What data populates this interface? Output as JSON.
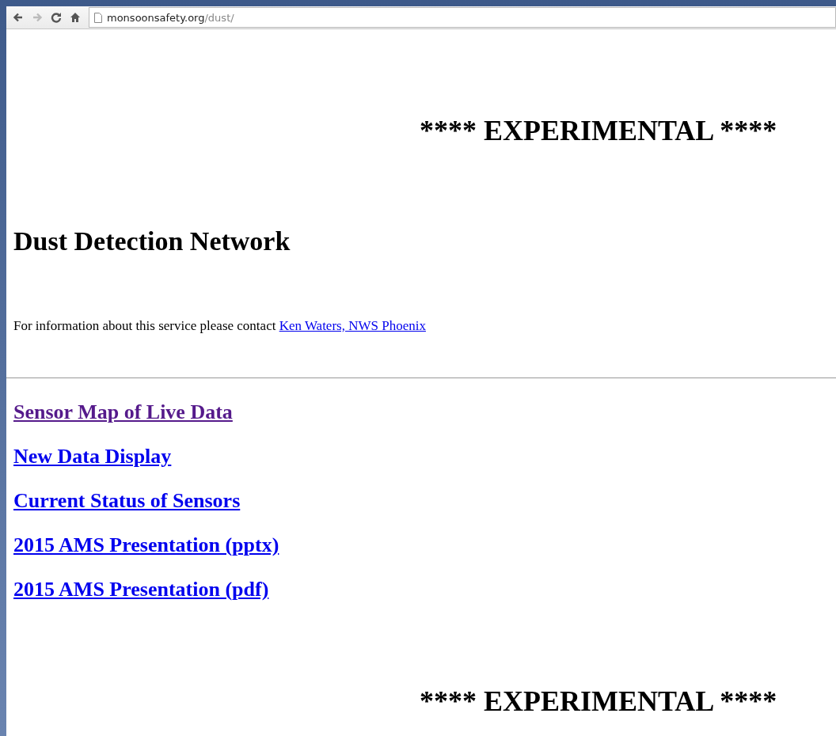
{
  "browser": {
    "back_disabled": false,
    "forward_disabled": true,
    "address_host": "monsoonsafety.org",
    "address_path": "/dust/"
  },
  "page": {
    "banner_top": "**** EXPERIMENTAL ****",
    "title": "Dust Detection Network",
    "contact_text": "For information about this service please contact",
    "contact_link": "Ken Waters, NWS Phoenix",
    "links": [
      {
        "label": "Sensor Map of Live Data",
        "visited": true
      },
      {
        "label": "New Data Display",
        "visited": false
      },
      {
        "label": "Current Status of Sensors",
        "visited": false
      },
      {
        "label": "2015 AMS Presentation (pptx)",
        "visited": false
      },
      {
        "label": "2015 AMS Presentation (pdf)",
        "visited": false
      }
    ],
    "banner_bottom": "**** EXPERIMENTAL ****"
  }
}
